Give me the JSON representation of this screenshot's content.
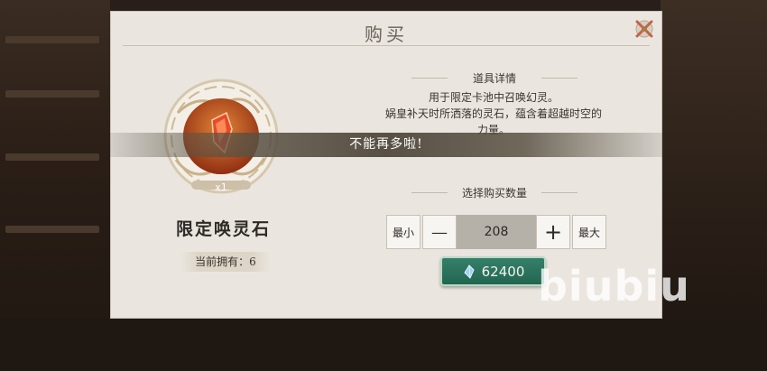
{
  "dialog": {
    "title": "购买"
  },
  "item": {
    "name": "限定唤灵石",
    "quantity_badge": "x1",
    "owned_text": "当前拥有：6"
  },
  "details": {
    "header": "道具详情",
    "description_line1": "用于限定卡池中召唤幻灵。",
    "description_line2": "娲皇补天时所洒落的灵石，蕴含着超越时空的",
    "description_line3": "力量。"
  },
  "banner": {
    "message": "不能再多啦!"
  },
  "quantity": {
    "header": "选择购买数量",
    "min_label": "最小",
    "minus_label": "—",
    "value": "208",
    "plus_label": "+",
    "max_label": "最大"
  },
  "purchase": {
    "price": "62400",
    "currency_icon": "spirit-crystal-icon"
  },
  "watermark": "biubiu",
  "colors": {
    "panel": "#eae6df",
    "buy_button": "#2c735d",
    "banner": "#504838"
  }
}
